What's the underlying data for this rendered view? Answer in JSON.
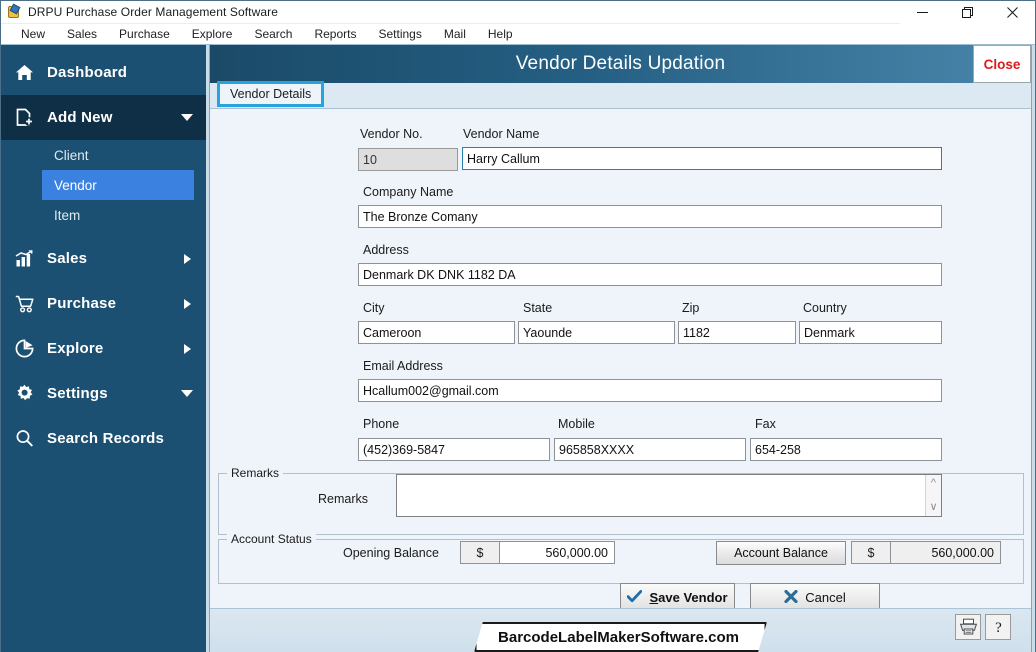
{
  "window": {
    "title": "DRPU Purchase Order Management Software",
    "icon": "app-icon",
    "controls": {
      "minimize": "minimize-icon",
      "maximize": "maximize-icon",
      "close": "close-icon"
    }
  },
  "menubar": {
    "items": [
      "New",
      "Sales",
      "Purchase",
      "Explore",
      "Search",
      "Reports",
      "Settings",
      "Mail",
      "Help"
    ]
  },
  "sidebar": {
    "items": [
      {
        "label": "Dashboard",
        "icon": "home-icon",
        "arrow": "none",
        "state": "normal"
      },
      {
        "label": "Add New",
        "icon": "add-file-icon",
        "arrow": "down",
        "state": "expanded"
      },
      {
        "label": "Sales",
        "icon": "chart-icon",
        "arrow": "right",
        "state": "normal"
      },
      {
        "label": "Purchase",
        "icon": "cart-icon",
        "arrow": "right",
        "state": "normal"
      },
      {
        "label": "Explore",
        "icon": "pie-icon",
        "arrow": "right",
        "state": "normal"
      },
      {
        "label": "Settings",
        "icon": "gear-icon",
        "arrow": "down",
        "state": "normal"
      },
      {
        "label": "Search Records",
        "icon": "search-icon",
        "arrow": "none",
        "state": "normal"
      }
    ],
    "subitems": [
      {
        "label": "Client",
        "selected": false
      },
      {
        "label": "Vendor",
        "selected": true
      },
      {
        "label": "Item",
        "selected": false
      }
    ],
    "colors": {
      "background": "#1b5072",
      "active_dark": "#0f2f46",
      "selected": "#3b82e0"
    }
  },
  "form": {
    "title": "Vendor Details Updation",
    "close_label": "Close",
    "tab_label": "Vendor Details",
    "header_colors": {
      "from": "#1b4a68",
      "to": "#4a86ab"
    },
    "close_color": "#e01b1b",
    "tab_focus_color": "#29a3dd",
    "labels": {
      "vendor_no": "Vendor No.",
      "vendor_name": "Vendor Name",
      "company_name": "Company Name",
      "address": "Address",
      "city": "City",
      "state": "State",
      "zip": "Zip",
      "country": "Country",
      "email": "Email Address",
      "phone": "Phone",
      "mobile": "Mobile",
      "fax": "Fax"
    },
    "values": {
      "vendor_no": "10",
      "vendor_name": "Harry Callum",
      "company_name": "The Bronze Comany",
      "address": "Denmark DK DNK 1182 DA",
      "city": "Cameroon",
      "state": "Yaounde",
      "zip": "1182",
      "country": "Denmark",
      "email": "Hcallum002@gmail.com",
      "phone": "(452)369-5847",
      "mobile": "965858XXXX",
      "fax": "654-258"
    },
    "remarks": {
      "legend": "Remarks",
      "field_label": "Remarks",
      "value": "",
      "scroll_up": "scroll-up-icon",
      "scroll_down": "scroll-down-icon"
    },
    "account_status": {
      "legend": "Account Status",
      "opening_balance_label": "Opening Balance",
      "opening_balance_currency": "$",
      "opening_balance_value": "560,000.00",
      "account_balance_button": "Account Balance",
      "account_balance_currency": "$",
      "account_balance_value": "560,000.00"
    },
    "buttons": {
      "save": {
        "accel": "S",
        "rest": "ave Vendor",
        "icon": "check-icon"
      },
      "cancel": {
        "label": "Cancel",
        "icon": "cross-icon"
      }
    }
  },
  "footer": {
    "banner": "BarcodeLabelMakerSoftware.com",
    "print_icon": "printer-icon",
    "help_icon": "help-icon"
  }
}
